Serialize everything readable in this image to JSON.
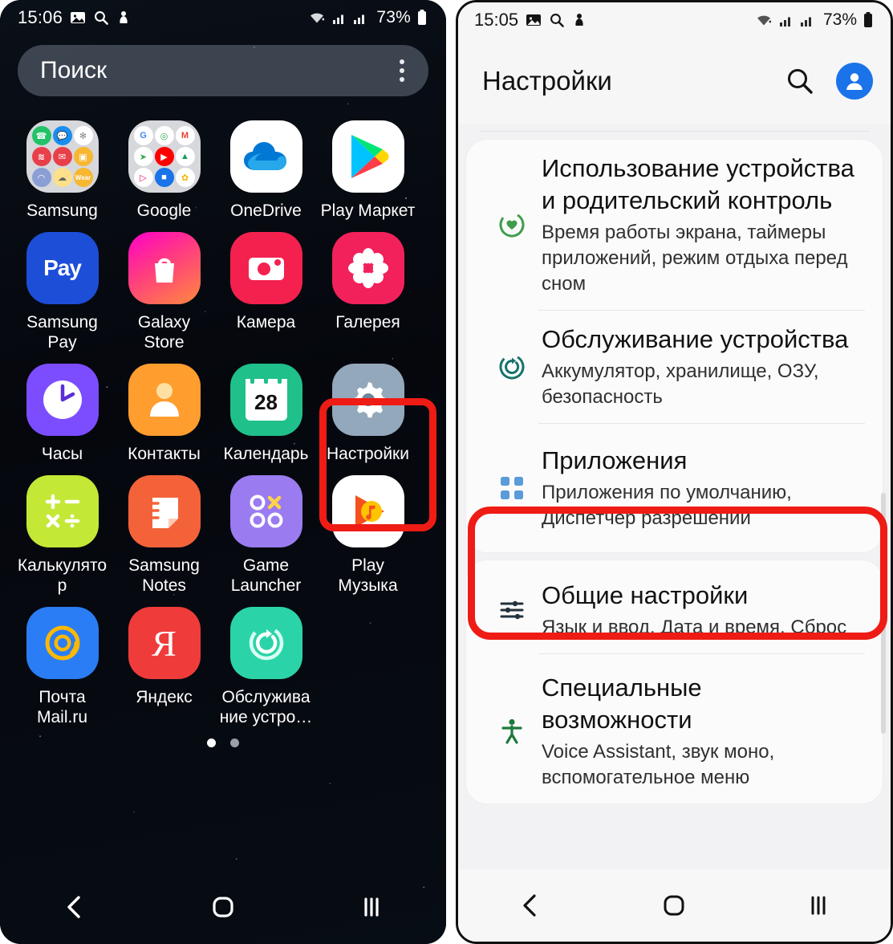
{
  "left_phone": {
    "status_bar": {
      "time": "15:06",
      "battery_percent": "73%",
      "icons": [
        "gallery-icon",
        "search-icon",
        "download-icon",
        "wifi-icon",
        "signal-icon-1",
        "signal-icon-2",
        "battery-icon"
      ]
    },
    "search": {
      "placeholder": "Поиск",
      "menu_icon": "kebab-menu-icon"
    },
    "apps": [
      [
        {
          "label": "Samsung",
          "icon": "samsung-folder-icon"
        },
        {
          "label": "Google",
          "icon": "google-folder-icon"
        },
        {
          "label": "OneDrive",
          "icon": "onedrive-icon"
        },
        {
          "label": "Play Маркет",
          "icon": "play-store-icon"
        }
      ],
      [
        {
          "label": "Samsung Pay",
          "icon": "samsung-pay-icon"
        },
        {
          "label": "Galaxy Store",
          "icon": "galaxy-store-icon"
        },
        {
          "label": "Камера",
          "icon": "camera-icon"
        },
        {
          "label": "Галерея",
          "icon": "gallery-app-icon"
        }
      ],
      [
        {
          "label": "Часы",
          "icon": "clock-icon"
        },
        {
          "label": "Контакты",
          "icon": "contacts-icon"
        },
        {
          "label": "Календарь",
          "icon": "calendar-icon"
        },
        {
          "label": "Настройки",
          "icon": "settings-gear-icon",
          "highlighted": true
        }
      ],
      [
        {
          "label": "Калькулятор",
          "icon": "calculator-icon"
        },
        {
          "label": "Samsung Notes",
          "icon": "samsung-notes-icon"
        },
        {
          "label": "Game Launcher",
          "icon": "game-launcher-icon"
        },
        {
          "label": "Play Музыка",
          "icon": "play-music-icon"
        }
      ],
      [
        {
          "label": "Почта Mail.ru",
          "icon": "mailru-icon"
        },
        {
          "label": "Яндекс",
          "icon": "yandex-icon"
        },
        {
          "label": "Обслуживание устро…",
          "icon": "device-care-icon"
        }
      ]
    ],
    "calendar_day": "28",
    "page_dots": {
      "count": 2,
      "active_index": 0
    },
    "nav_bar": {
      "back": "back-icon",
      "home": "home-icon",
      "recents": "recents-icon"
    }
  },
  "right_phone": {
    "status_bar": {
      "time": "15:05",
      "battery_percent": "73%"
    },
    "header": {
      "title": "Настройки",
      "search_icon": "search-icon",
      "account_icon": "account-avatar-icon"
    },
    "settings_items": [
      {
        "title": "Использование устройства и родительский контроль",
        "subtitle": "Время работы экрана, таймеры приложений, режим отдыха перед сном",
        "icon": "digital-wellbeing-icon",
        "icon_color": "#3f9c4a"
      },
      {
        "title": "Обслуживание устройства",
        "subtitle": "Аккумулятор, хранилище, ОЗУ, безопасность",
        "icon": "device-care-icon",
        "icon_color": "#17726b"
      },
      {
        "title": "Приложения",
        "subtitle": "Приложения по умолчанию, Диспетчер разрешений",
        "icon": "apps-grid-icon",
        "icon_color": "#5a9bd8",
        "highlighted": true
      },
      {
        "title": "Общие настройки",
        "subtitle": "Язык и ввод, Дата и время, Сброс",
        "icon": "sliders-icon",
        "icon_color": "#23323c"
      },
      {
        "title": "Специальные возможности",
        "subtitle": "Voice Assistant, звук моно, вспомогательное меню",
        "icon": "accessibility-icon",
        "icon_color": "#1d7a3c"
      }
    ],
    "nav_bar": {
      "back": "back-icon",
      "home": "home-icon",
      "recents": "recents-icon"
    }
  },
  "annotation": {
    "highlight_color": "#ee1c15"
  }
}
